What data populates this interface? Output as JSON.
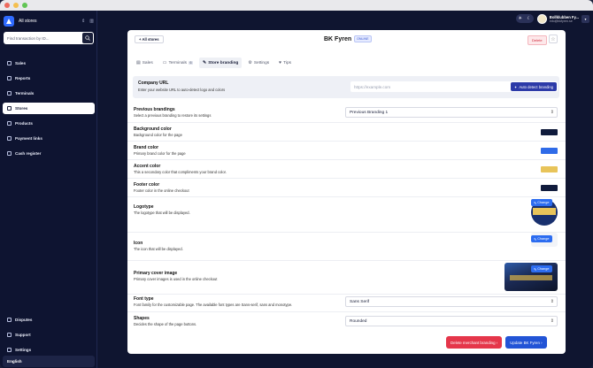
{
  "sidebar": {
    "store_switch": "All stores",
    "search_placeholder": "Find transaction by ID...",
    "nav": [
      "Sales",
      "Reports",
      "Terminals",
      "Stores",
      "Products",
      "Payment links",
      "Cash register"
    ],
    "active_index": 3,
    "bottom_nav": [
      "Disputes",
      "Support",
      "Settings"
    ],
    "language": "English"
  },
  "user": {
    "name": "Bollklubben Fy...",
    "email": "info@bkfyren.se"
  },
  "store": {
    "back_label": "+ All stores",
    "title": "BK Fyren",
    "status": "ONLINE",
    "delete_label": "Delete",
    "star_icon": "star-icon"
  },
  "tabs": [
    {
      "label": "Sales",
      "icon": "sales-icon"
    },
    {
      "label": "Terminals",
      "icon": "terminal-icon",
      "count": "6"
    },
    {
      "label": "Store branding",
      "icon": "brush-icon"
    },
    {
      "label": "Settings",
      "icon": "settings-icon"
    },
    {
      "label": "Tips",
      "icon": "tips-icon"
    }
  ],
  "active_tab": 2,
  "company_url": {
    "label": "Company URL",
    "desc": "Enter your website URL to auto-detect logo and colors",
    "placeholder": "https://example.com",
    "button": "Auto detect branding"
  },
  "previous_brandings": {
    "label": "Previous brandings",
    "desc": "Select a previous branding to restore its settings",
    "value": "Previous Branding 1"
  },
  "colors": [
    {
      "label": "Background color",
      "desc": "Background color for the page",
      "color": "#101b3c"
    },
    {
      "label": "Brand color",
      "desc": "Primary brand color for the page",
      "color": "#2f6be8"
    },
    {
      "label": "Accent color",
      "desc": "This a secondary color that compliments your brand color.",
      "color": "#e8c45a"
    },
    {
      "label": "Footer color",
      "desc": "Footer color in the online checkout",
      "color": "#101b3c"
    }
  ],
  "logotype": {
    "label": "Logotype",
    "desc": "The logotype that will be displayed.",
    "button": "Change"
  },
  "icon": {
    "label": "Icon",
    "desc": "The icon that will be displayed.",
    "button": "Change"
  },
  "cover": {
    "label": "Primary cover image",
    "desc": "Primary cover images is used in the online checkout",
    "button": "Change"
  },
  "font_type": {
    "label": "Font type",
    "desc": "Font family for the customizable page. The available font types are Sans-serif, sans and monotype.",
    "value": "Sans Serif"
  },
  "shapes": {
    "label": "Shapes",
    "desc": "Decides the shape of the page buttons.",
    "value": "Rounded"
  },
  "footer": {
    "delete_branding": "Delete merchant branding ›",
    "update": "Update BK Fyren ›"
  }
}
